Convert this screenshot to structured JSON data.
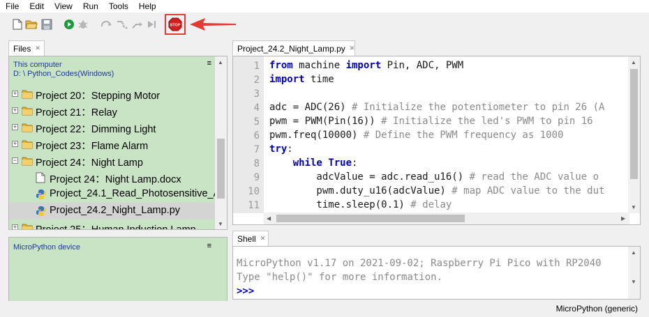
{
  "menu": [
    "File",
    "Edit",
    "View",
    "Run",
    "Tools",
    "Help"
  ],
  "toolbar": {
    "icons": [
      "new-file-icon",
      "open-folder-icon",
      "save-icon",
      "run-icon",
      "debug-icon",
      "step-over-icon",
      "step-into-icon",
      "step-out-icon",
      "resume-icon",
      "stop-icon"
    ],
    "stop_label": "STOP",
    "highlight_color": "#e53935"
  },
  "files": {
    "tab_label": "Files",
    "location_line1": "This computer",
    "location_line2": "D: \\ Python_Codes(Windows)",
    "menu_glyph": "≡",
    "items": [
      {
        "label": "Project 20：Stepping Motor",
        "type": "folder",
        "level": 0
      },
      {
        "label": "Project 21：Relay",
        "type": "folder",
        "level": 0
      },
      {
        "label": "Project 22：Dimming Light",
        "type": "folder",
        "level": 0
      },
      {
        "label": "Project 23：Flame Alarm",
        "type": "folder",
        "level": 0
      },
      {
        "label": "Project 24：Night Lamp",
        "type": "folder-open",
        "level": 0
      },
      {
        "label": "Project 24：Night Lamp.docx",
        "type": "doc",
        "level": 1
      },
      {
        "label": "Project_24.1_Read_Photosensitive_A",
        "type": "python",
        "level": 1
      },
      {
        "label": "Project_24.2_Night_Lamp.py",
        "type": "python",
        "level": 1,
        "selected": true
      },
      {
        "label": "Project 25：Human  Induction Lamp",
        "type": "folder",
        "level": 0
      }
    ],
    "micro_title": "MicroPython device"
  },
  "editor": {
    "tab_label": "Project_24.2_Night_Lamp.py",
    "line_numbers": [
      "1",
      "2",
      "3",
      "4",
      "5",
      "6",
      "7",
      "8",
      "9",
      "10",
      "11"
    ],
    "lines": [
      [
        {
          "t": "from",
          "c": "kw"
        },
        {
          "t": " machine ",
          "c": "nm"
        },
        {
          "t": "import",
          "c": "kw"
        },
        {
          "t": " Pin, ADC, PWM",
          "c": "nm"
        }
      ],
      [
        {
          "t": "import",
          "c": "kw"
        },
        {
          "t": " time",
          "c": "nm"
        }
      ],
      [],
      [
        {
          "t": "adc = ADC(26) ",
          "c": "nm"
        },
        {
          "t": "# Initialize the potentiometer to pin 26 (A",
          "c": "cm"
        }
      ],
      [
        {
          "t": "pwm = PWM(Pin(16)) ",
          "c": "nm"
        },
        {
          "t": "# Initialize the led's PWM to pin 16",
          "c": "cm"
        }
      ],
      [
        {
          "t": "pwm.freq(10000) ",
          "c": "nm"
        },
        {
          "t": "# Define the PWM frequency as 1000",
          "c": "cm"
        }
      ],
      [
        {
          "t": "try",
          "c": "kw"
        },
        {
          "t": ":",
          "c": "nm"
        }
      ],
      [
        {
          "t": "    ",
          "c": "nm"
        },
        {
          "t": "while",
          "c": "kw"
        },
        {
          "t": " ",
          "c": "nm"
        },
        {
          "t": "True",
          "c": "kw"
        },
        {
          "t": ":",
          "c": "nm"
        }
      ],
      [
        {
          "t": "        adcValue = adc.read_u16() ",
          "c": "nm"
        },
        {
          "t": "# read the ADC value o",
          "c": "cm"
        }
      ],
      [
        {
          "t": "        pwm.duty_u16(adcValue) ",
          "c": "nm"
        },
        {
          "t": "# map ADC value to the dut",
          "c": "cm"
        }
      ],
      [
        {
          "t": "        time.sleep(0.1) ",
          "c": "nm"
        },
        {
          "t": "# delay",
          "c": "cm"
        }
      ]
    ]
  },
  "shell": {
    "tab_label": "Shell",
    "line1": "MicroPython v1.17 on 2021-09-02; Raspberry Pi Pico with RP2040",
    "line2": "Type \"help()\" for more information.",
    "prompt": ">>>"
  },
  "status": "MicroPython (generic)"
}
